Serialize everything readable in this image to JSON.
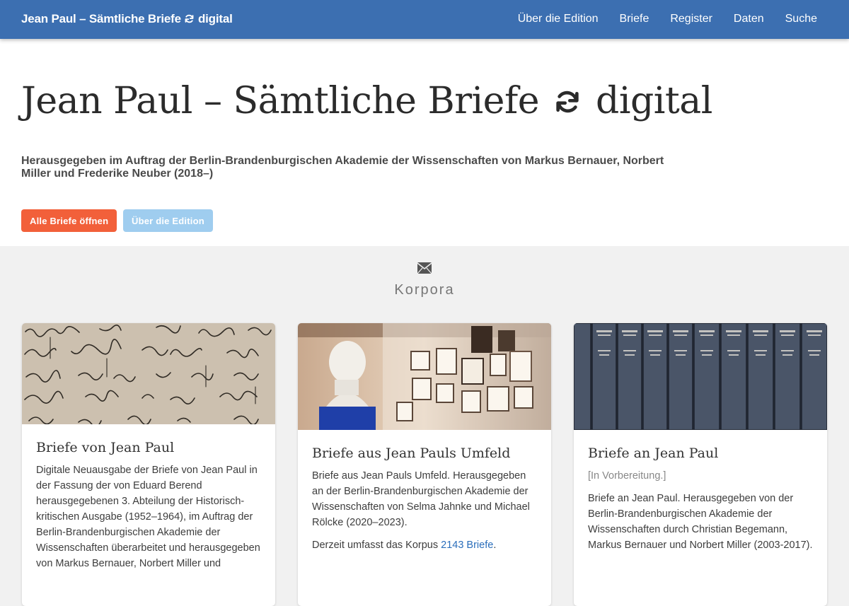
{
  "navbar": {
    "brand_left": "Jean Paul – Sämtliche Briefe",
    "brand_right": "digital",
    "links": [
      "Über die Edition",
      "Briefe",
      "Register",
      "Daten",
      "Suche"
    ]
  },
  "hero": {
    "title_left": "Jean Paul – Sämtliche Briefe",
    "title_right": "digital",
    "subtitle": "Herausgegeben im Auftrag der Berlin-Brandenburgischen Akademie der Wissenschaften von Markus Bernauer, Norbert Miller und Frederike Neuber (2018–)",
    "primary_button": "Alle Briefe öffnen",
    "secondary_button": "Über die Edition"
  },
  "section": {
    "icon": "envelope-icon",
    "title": "Korpora"
  },
  "cards": [
    {
      "title": "Briefe von Jean Paul",
      "text": "Digitale Neuausgabe der Briefe von Jean Paul in der Fassung der von Eduard Berend herausgegebenen 3. Abteilung der Historisch-kritischen Ausgabe (1952–1964), im Auftrag der Berlin-Brandenburgischen Akademie der Wissenschaften überarbeitet und herausgegeben von Markus Bernauer, Norbert Miller und"
    },
    {
      "title": "Briefe aus Jean Pauls Umfeld",
      "text": "Briefe aus Jean Pauls Umfeld. Herausgegeben an der Berlin-Brandenburgischen Akademie der Wissenschaften von Selma Jahnke und Michael Rölcke (2020–2023).",
      "text2_prefix": "Derzeit umfasst das Korpus ",
      "link": "2143 Briefe",
      "text2_suffix": "."
    },
    {
      "title": "Briefe an Jean Paul",
      "note": "[In Vorbereitung.]",
      "text": "Briefe an Jean Paul. Herausgegeben von der Berlin-Brandenburgischen Akademie der Wissenschaften durch Christian Begemann, Markus Bernauer und Norbert Miller (2003-2017)."
    }
  ],
  "colors": {
    "navbar": "#3c6fb1",
    "primary_button": "#f2603a",
    "secondary_button": "#9fcdef",
    "link": "#2a6ebb"
  }
}
